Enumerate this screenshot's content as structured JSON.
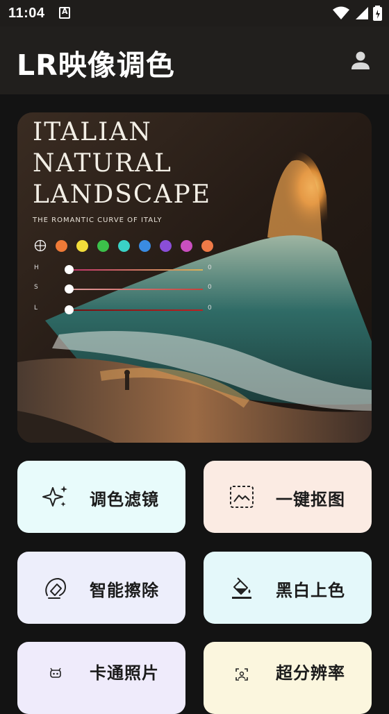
{
  "status": {
    "time": "11:04"
  },
  "appbar": {
    "title": "LR映像调色"
  },
  "hero": {
    "title_lines": [
      "ITALIAN",
      "NATURAL",
      "LANDSCAPE"
    ],
    "subtitle": "THE ROMANTIC CURVE OF ITALY",
    "swatch_colors": [
      "#ef7a37",
      "#f2dc3a",
      "#3cc04a",
      "#3ad1c6",
      "#3a8be2",
      "#8a4ed8",
      "#c94fbf",
      "#ef7a47"
    ],
    "sliders": [
      {
        "label": "H",
        "value": "0",
        "color": "#d8b35a"
      },
      {
        "label": "S",
        "value": "0",
        "color": "#c5403a"
      },
      {
        "label": "L",
        "value": "0",
        "color": "#a82020"
      }
    ]
  },
  "features": [
    {
      "label": "调色滤镜",
      "icon": "sparkle-icon",
      "bg": "#e8fbfb"
    },
    {
      "label": "一键抠图",
      "icon": "cutout-icon",
      "bg": "#fbebe3"
    },
    {
      "label": "智能擦除",
      "icon": "eraser-icon",
      "bg": "#edeefb"
    },
    {
      "label": "黑白上色",
      "icon": "paint-bucket-icon",
      "bg": "#e4f8fa"
    },
    {
      "label": "卡通照片",
      "icon": "cartoon-robot-icon",
      "bg": "#efebfb"
    },
    {
      "label": "超分辨率",
      "icon": "scan-face-icon",
      "bg": "#fbf6de"
    }
  ]
}
